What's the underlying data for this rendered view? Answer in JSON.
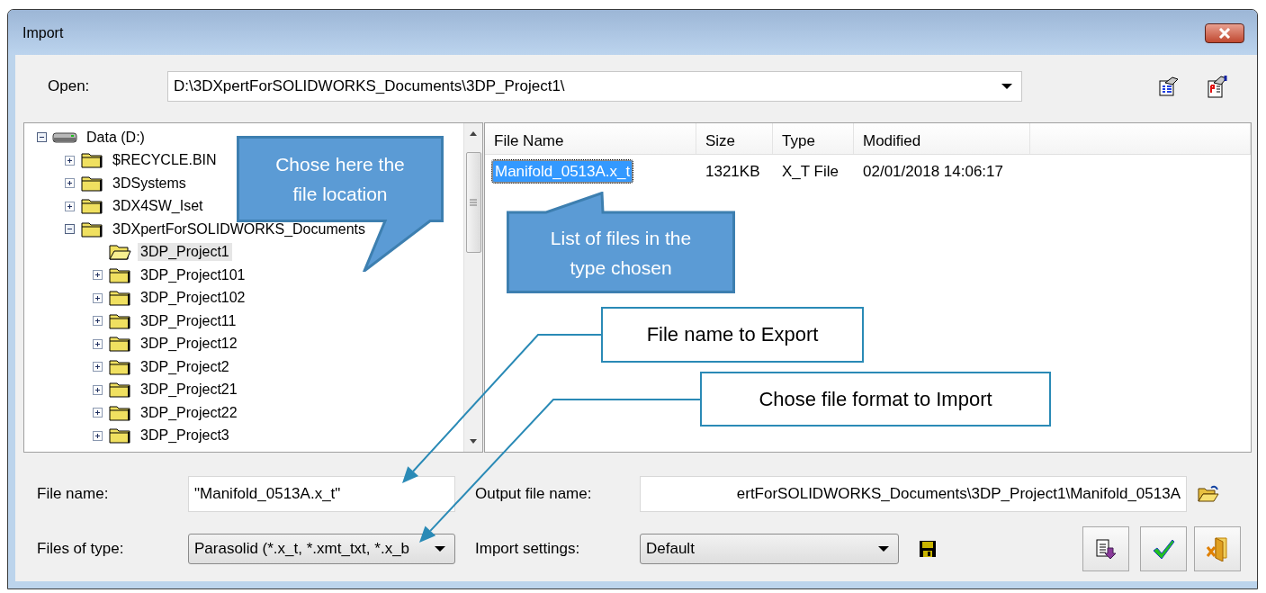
{
  "window": {
    "title": "Import"
  },
  "open": {
    "label": "Open:",
    "value": "D:\\3DXpertForSOLIDWORKS_Documents\\3DP_Project1\\"
  },
  "tree": {
    "items": [
      {
        "kind": "drive",
        "label": "Data (D:)",
        "expandable": true,
        "expanded": true,
        "selected": false,
        "children": [
          {
            "kind": "folder",
            "label": "$RECYCLE.BIN",
            "expandable": true,
            "expanded": false,
            "selected": false
          },
          {
            "kind": "folder",
            "label": "3DSystems",
            "expandable": true,
            "expanded": false,
            "selected": false
          },
          {
            "kind": "folder",
            "label": "3DX4SW_Iset",
            "expandable": true,
            "expanded": false,
            "selected": false
          },
          {
            "kind": "folder",
            "label": "3DXpertForSOLIDWORKS_Documents",
            "expandable": true,
            "expanded": true,
            "selected": false,
            "children": [
              {
                "kind": "folder",
                "label": "3DP_Project1",
                "expandable": false,
                "expanded": false,
                "selected": true
              },
              {
                "kind": "folder",
                "label": "3DP_Project101",
                "expandable": true,
                "expanded": false,
                "selected": false
              },
              {
                "kind": "folder",
                "label": "3DP_Project102",
                "expandable": true,
                "expanded": false,
                "selected": false
              },
              {
                "kind": "folder",
                "label": "3DP_Project11",
                "expandable": true,
                "expanded": false,
                "selected": false
              },
              {
                "kind": "folder",
                "label": "3DP_Project12",
                "expandable": true,
                "expanded": false,
                "selected": false
              },
              {
                "kind": "folder",
                "label": "3DP_Project2",
                "expandable": true,
                "expanded": false,
                "selected": false
              },
              {
                "kind": "folder",
                "label": "3DP_Project21",
                "expandable": true,
                "expanded": false,
                "selected": false
              },
              {
                "kind": "folder",
                "label": "3DP_Project22",
                "expandable": true,
                "expanded": false,
                "selected": false
              },
              {
                "kind": "folder",
                "label": "3DP_Project3",
                "expandable": true,
                "expanded": false,
                "selected": false
              }
            ]
          }
        ]
      }
    ]
  },
  "file_list": {
    "columns": [
      "File Name",
      "Size",
      "Type",
      "Modified"
    ],
    "rows": [
      {
        "cells": [
          "Manifold_0513A.x_t",
          "1321KB",
          "X_T File",
          "02/01/2018 14:06:17"
        ],
        "selected": true
      }
    ]
  },
  "file_name": {
    "label": "File name:",
    "value": "\"Manifold_0513A.x_t\""
  },
  "output_file_name": {
    "label": "Output file name:",
    "value": "ertForSOLIDWORKS_Documents\\3DP_Project1\\Manifold_0513A"
  },
  "files_of_type": {
    "label": "Files of type:",
    "value": "Parasolid (*.x_t, *.xmt_txt, *.x_b"
  },
  "import_settings": {
    "label": "Import settings:",
    "value": "Default"
  },
  "callouts": [
    {
      "kind": "bubble",
      "text": "Chose here the file location"
    },
    {
      "kind": "bubble",
      "text": "List of files in the type chosen"
    },
    {
      "kind": "box",
      "text": "File name to Export"
    },
    {
      "kind": "box",
      "text": "Chose file format to Import"
    }
  ]
}
